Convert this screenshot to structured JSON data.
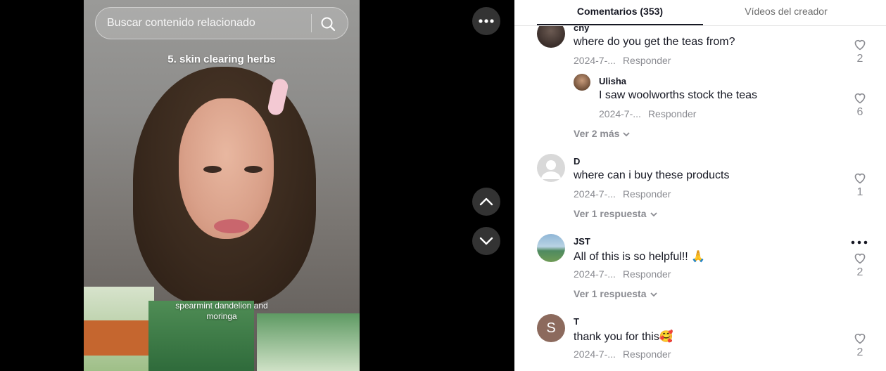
{
  "search": {
    "placeholder": "Buscar contenido relacionado"
  },
  "video": {
    "caption_top": "5. skin clearing herbs",
    "caption_bottom": "spearmint dandelion and moringa"
  },
  "controls": {
    "more_icon": "ellipsis-icon",
    "up_icon": "chevron-up-icon",
    "down_icon": "chevron-down-icon"
  },
  "tabs": {
    "comments": "Comentarios (353)",
    "videos": "Vídeos del creador"
  },
  "comments": [
    {
      "user": "chy",
      "text": "where do you get the teas from?",
      "date": "2024-7-...",
      "reply": "Responder",
      "likes": "2",
      "replies": [
        {
          "user": "Ulisha",
          "text": "I saw woolworths stock the teas",
          "date": "2024-7-...",
          "reply": "Responder",
          "likes": "6"
        }
      ],
      "view_more": "Ver 2 más"
    },
    {
      "user": "D",
      "text": "where can i buy these products",
      "date": "2024-7-...",
      "reply": "Responder",
      "likes": "1",
      "view_more": "Ver 1 respuesta"
    },
    {
      "user": "JST",
      "text": "All of this is so helpful!! 🙏",
      "date": "2024-7-...",
      "reply": "Responder",
      "likes": "2",
      "view_more": "Ver 1 respuesta"
    },
    {
      "user": "T",
      "avatar_letter": "S",
      "text": "thank you for this🥰",
      "date": "2024-7-...",
      "reply": "Responder",
      "likes": "2"
    }
  ],
  "colors": {
    "accent": "#161823",
    "muted": "#8a8b91",
    "avatar_s": "#8c6a5d"
  }
}
